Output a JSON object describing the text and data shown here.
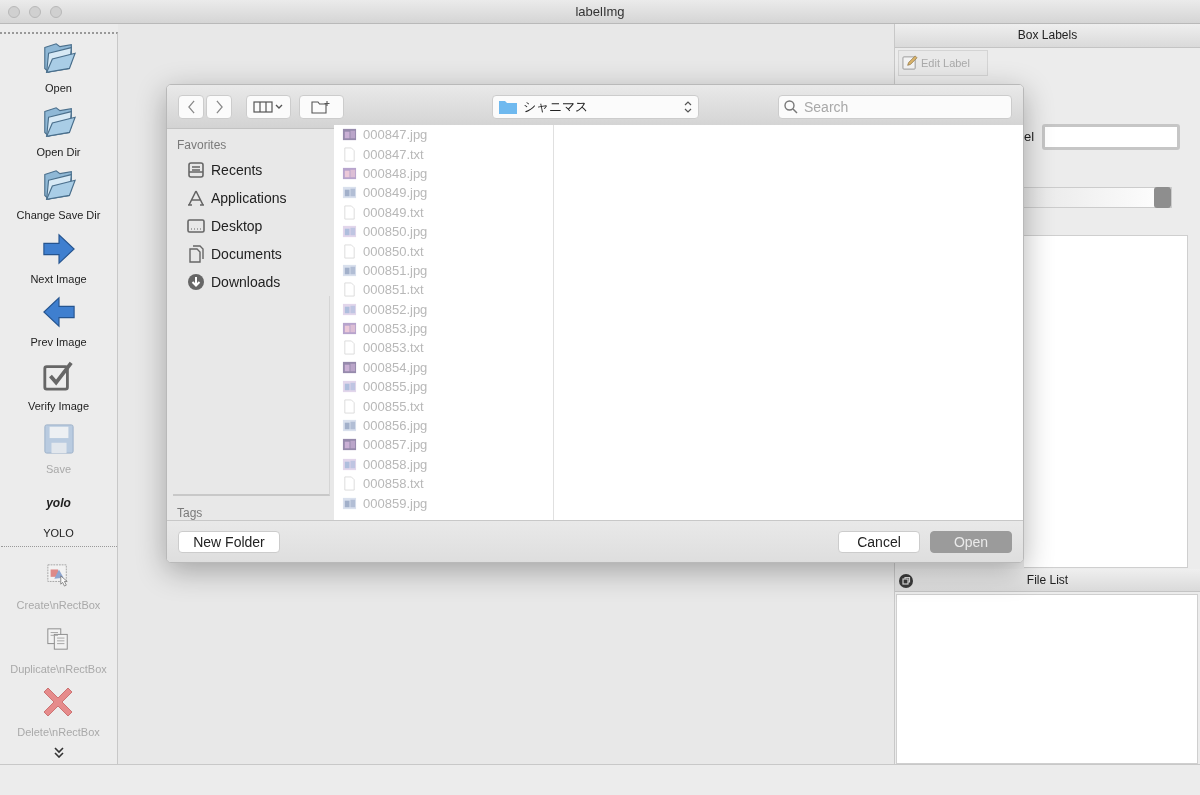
{
  "window": {
    "title": "labelImg"
  },
  "toolbar": [
    {
      "kind": "folder",
      "label": "Open",
      "disabled": false
    },
    {
      "kind": "folder",
      "label": "Open Dir",
      "disabled": false
    },
    {
      "kind": "folder",
      "label": "Change Save Dir",
      "disabled": false
    },
    {
      "kind": "next",
      "label": "Next Image",
      "disabled": false
    },
    {
      "kind": "prev",
      "label": "Prev Image",
      "disabled": false
    },
    {
      "kind": "verify",
      "label": "Verify Image",
      "disabled": false
    },
    {
      "kind": "save",
      "label": "Save",
      "disabled": true
    },
    {
      "kind": "format",
      "icon_text": "yolo",
      "label": "YOLO",
      "disabled": false
    },
    {
      "kind": "separator"
    },
    {
      "kind": "create",
      "label": "Create\\nRectBox",
      "disabled": true
    },
    {
      "kind": "duplicate",
      "label": "Duplicate\\nRectBox",
      "disabled": true
    },
    {
      "kind": "delete",
      "label": "Delete\\nRectBox",
      "disabled": true
    },
    {
      "kind": "more"
    }
  ],
  "box_labels": {
    "title": "Box Labels",
    "edit_button": {
      "label": "Edit Label",
      "disabled": true
    },
    "label_fragment": "el"
  },
  "file_list": {
    "title": "File List"
  },
  "dialog": {
    "path": "シャニマス",
    "search": {
      "placeholder": "Search"
    },
    "sidebar": {
      "heading": "Favorites",
      "items": [
        {
          "kind": "recents",
          "label": "Recents"
        },
        {
          "kind": "applications",
          "label": "Applications"
        },
        {
          "kind": "desktop",
          "label": "Desktop"
        },
        {
          "kind": "documents",
          "label": "Documents"
        },
        {
          "kind": "downloads",
          "label": "Downloads"
        }
      ],
      "tags_heading": "Tags"
    },
    "files": [
      {
        "kind": "image",
        "name": "000847.jpg",
        "disabled": true
      },
      {
        "kind": "text",
        "name": "000847.txt",
        "disabled": true
      },
      {
        "kind": "image",
        "name": "000848.jpg",
        "disabled": true
      },
      {
        "kind": "image",
        "name": "000849.jpg",
        "disabled": true
      },
      {
        "kind": "text",
        "name": "000849.txt",
        "disabled": true
      },
      {
        "kind": "image",
        "name": "000850.jpg",
        "disabled": true
      },
      {
        "kind": "text",
        "name": "000850.txt",
        "disabled": true
      },
      {
        "kind": "image",
        "name": "000851.jpg",
        "disabled": true
      },
      {
        "kind": "text",
        "name": "000851.txt",
        "disabled": true
      },
      {
        "kind": "image",
        "name": "000852.jpg",
        "disabled": true
      },
      {
        "kind": "image",
        "name": "000853.jpg",
        "disabled": true
      },
      {
        "kind": "text",
        "name": "000853.txt",
        "disabled": true
      },
      {
        "kind": "image",
        "name": "000854.jpg",
        "disabled": true
      },
      {
        "kind": "image",
        "name": "000855.jpg",
        "disabled": true
      },
      {
        "kind": "text",
        "name": "000855.txt",
        "disabled": true
      },
      {
        "kind": "image",
        "name": "000856.jpg",
        "disabled": true
      },
      {
        "kind": "image",
        "name": "000857.jpg",
        "disabled": true
      },
      {
        "kind": "image",
        "name": "000858.jpg",
        "disabled": true
      },
      {
        "kind": "text",
        "name": "000858.txt",
        "disabled": true
      },
      {
        "kind": "image",
        "name": "000859.jpg",
        "disabled": true
      }
    ],
    "buttons": [
      {
        "kind": "new-folder",
        "label": "New Folder",
        "disabled": false
      },
      {
        "kind": "cancel",
        "label": "Cancel",
        "disabled": false
      },
      {
        "kind": "open",
        "label": "Open",
        "disabled": true
      }
    ]
  }
}
